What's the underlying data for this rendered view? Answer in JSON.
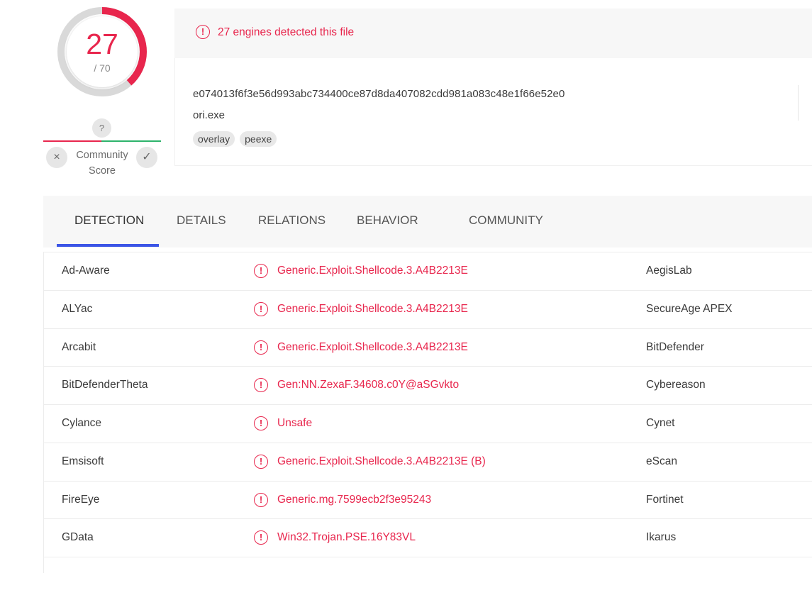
{
  "score": {
    "detected": "27",
    "total": "/ 70",
    "ratio": 0.3857
  },
  "community": {
    "question": "?",
    "label": "Community Score",
    "x_icon": "×",
    "check_icon": "✓"
  },
  "banner": {
    "icon": "!",
    "text": "27 engines detected this file"
  },
  "file": {
    "hash": "e074013f6f3e56d993abc734400ce87d8da407082cdd981a083c48e1f66e52e0",
    "name": "ori.exe",
    "tags": [
      "overlay",
      "peexe"
    ]
  },
  "tabs": [
    {
      "label": "DETECTION",
      "active": true
    },
    {
      "label": "DETAILS"
    },
    {
      "label": "RELATIONS"
    },
    {
      "label": "BEHAVIOR"
    },
    {
      "label": "COMMUNITY"
    }
  ],
  "colors": {
    "malicious": "#e8264d",
    "accent": "#3b55e6",
    "positive": "#2db36b"
  },
  "detections": [
    {
      "vendor": "Ad-Aware",
      "result": "Generic.Exploit.Shellcode.3.A4B2213E",
      "vendor2": "AegisLab"
    },
    {
      "vendor": "ALYac",
      "result": "Generic.Exploit.Shellcode.3.A4B2213E",
      "vendor2": "SecureAge APEX"
    },
    {
      "vendor": "Arcabit",
      "result": "Generic.Exploit.Shellcode.3.A4B2213E",
      "vendor2": "BitDefender"
    },
    {
      "vendor": "BitDefenderTheta",
      "result": "Gen:NN.ZexaF.34608.c0Y@aSGvkto",
      "vendor2": "Cybereason"
    },
    {
      "vendor": "Cylance",
      "result": "Unsafe",
      "vendor2": "Cynet"
    },
    {
      "vendor": "Emsisoft",
      "result": "Generic.Exploit.Shellcode.3.A4B2213E (B)",
      "vendor2": "eScan"
    },
    {
      "vendor": "FireEye",
      "result": "Generic.mg.7599ecb2f3e95243",
      "vendor2": "Fortinet"
    },
    {
      "vendor": "GData",
      "result": "Win32.Trojan.PSE.16Y83VL",
      "vendor2": "Ikarus"
    }
  ]
}
